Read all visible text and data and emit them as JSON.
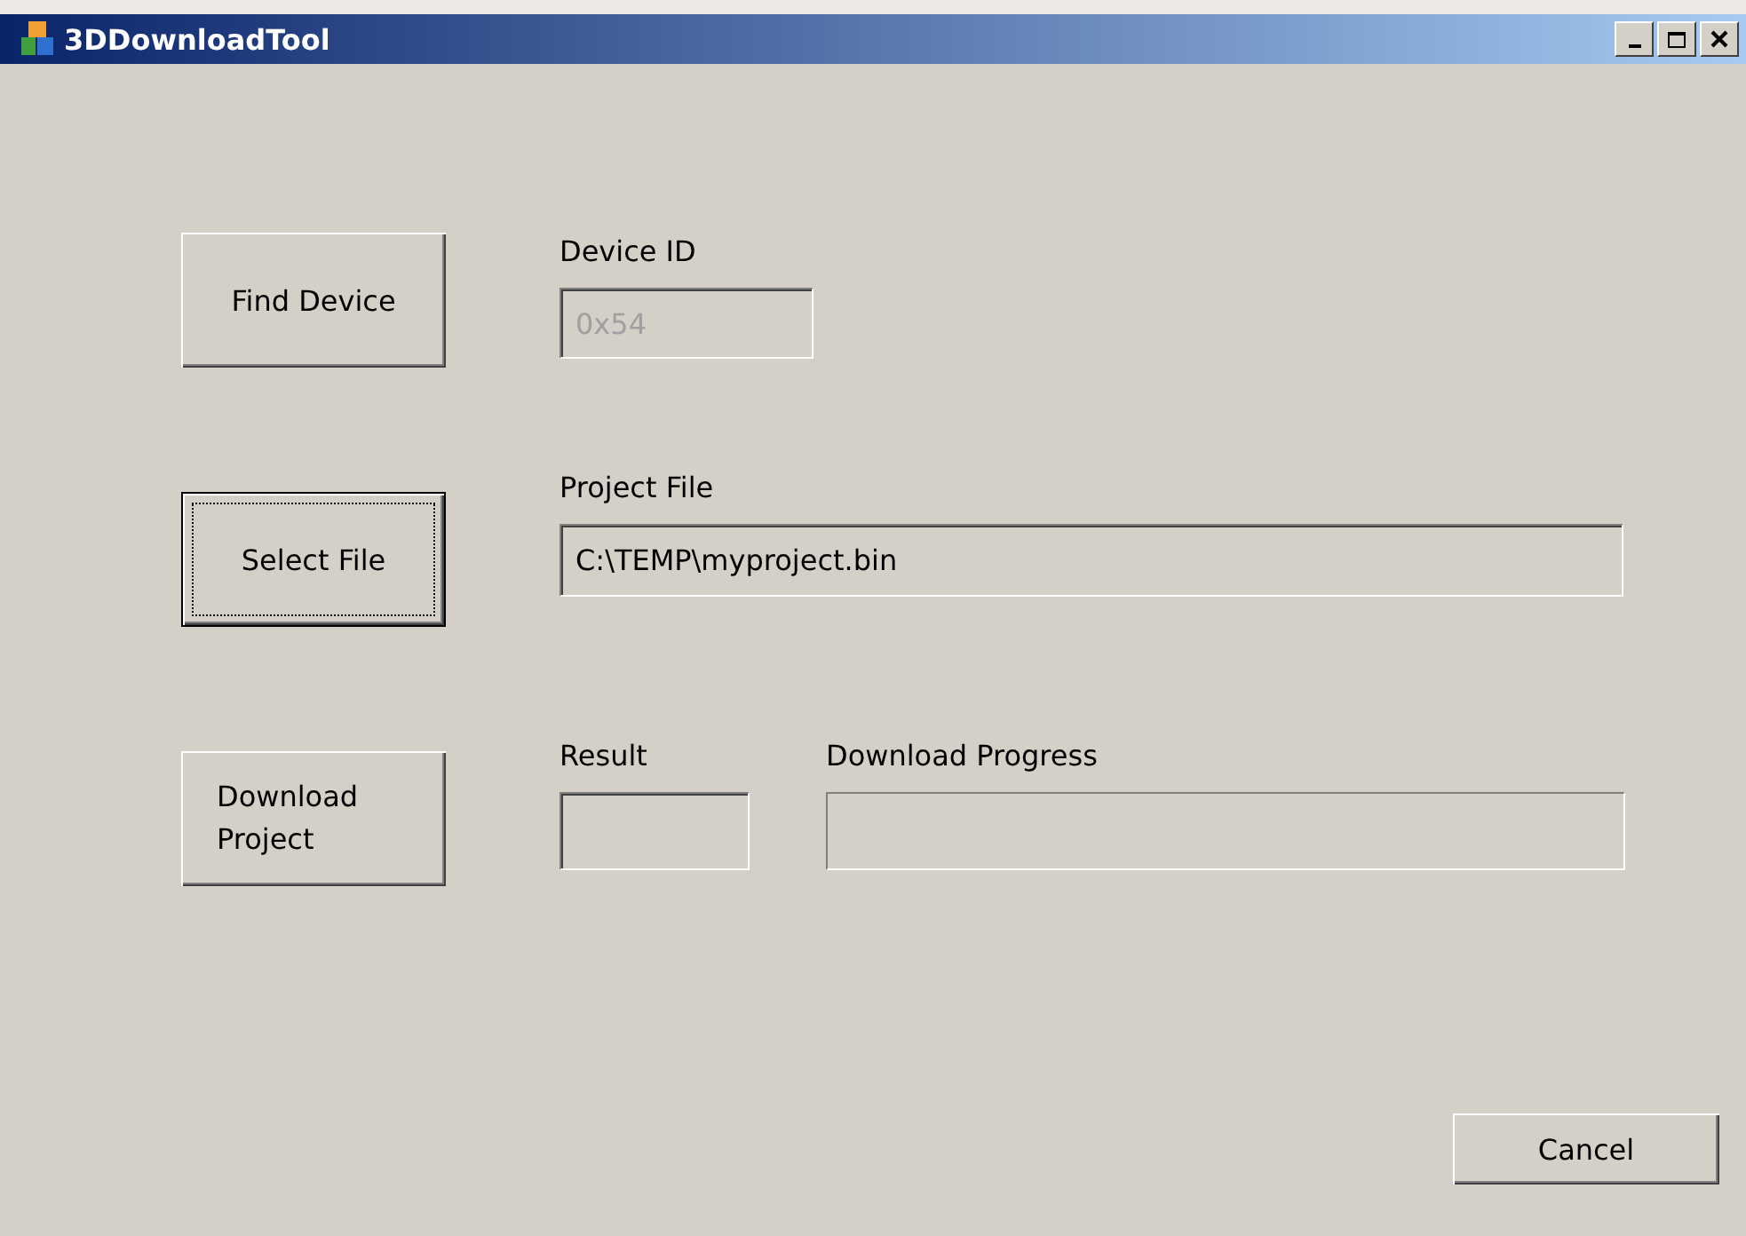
{
  "window": {
    "title": "3DDownloadTool"
  },
  "find_device": {
    "button": "Find Device",
    "label": "Device ID",
    "value": "0x54",
    "disabled": true
  },
  "project_file": {
    "button": "Select File",
    "focused": true,
    "label": "Project File",
    "value": "C:\\TEMP\\myproject.bin",
    "disabled": false
  },
  "download": {
    "button": "Download Project",
    "result_label": "Result",
    "progress_label": "Download Progress",
    "level": 0
  },
  "cancel": "Cancel"
}
